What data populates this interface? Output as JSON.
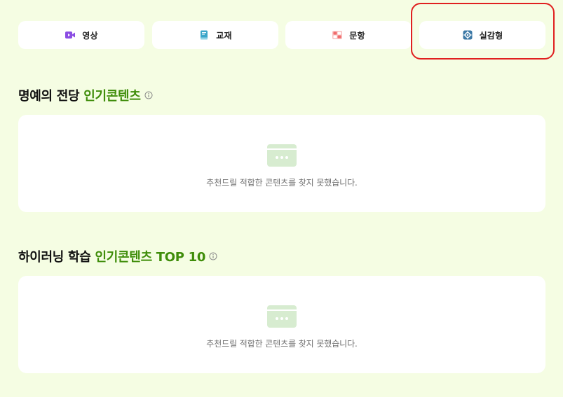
{
  "tabs": [
    {
      "label": "영상",
      "icon": "video-camera-icon",
      "color": "#8b4de3"
    },
    {
      "label": "교재",
      "icon": "book-icon",
      "color": "#3aa6c9"
    },
    {
      "label": "문항",
      "icon": "question-grid-icon",
      "color": "#f06b6b"
    },
    {
      "label": "실감형",
      "icon": "gear-cube-icon",
      "color": "#3d79a6"
    }
  ],
  "sections": [
    {
      "title": "명예의 전당",
      "title_accent": "인기콘텐츠",
      "empty_message": "추천드릴 적합한 콘텐츠를 찾지 못했습니다."
    },
    {
      "title": "하이러닝 학습",
      "title_accent": "인기콘텐츠 TOP 10",
      "empty_message": "추천드릴 적합한 콘텐츠를 찾지 못했습니다."
    }
  ],
  "colors": {
    "background": "#f5fde3",
    "accent_green": "#3f8d0a",
    "highlight_red": "#e02020",
    "empty_icon": "#d7ecd0"
  }
}
